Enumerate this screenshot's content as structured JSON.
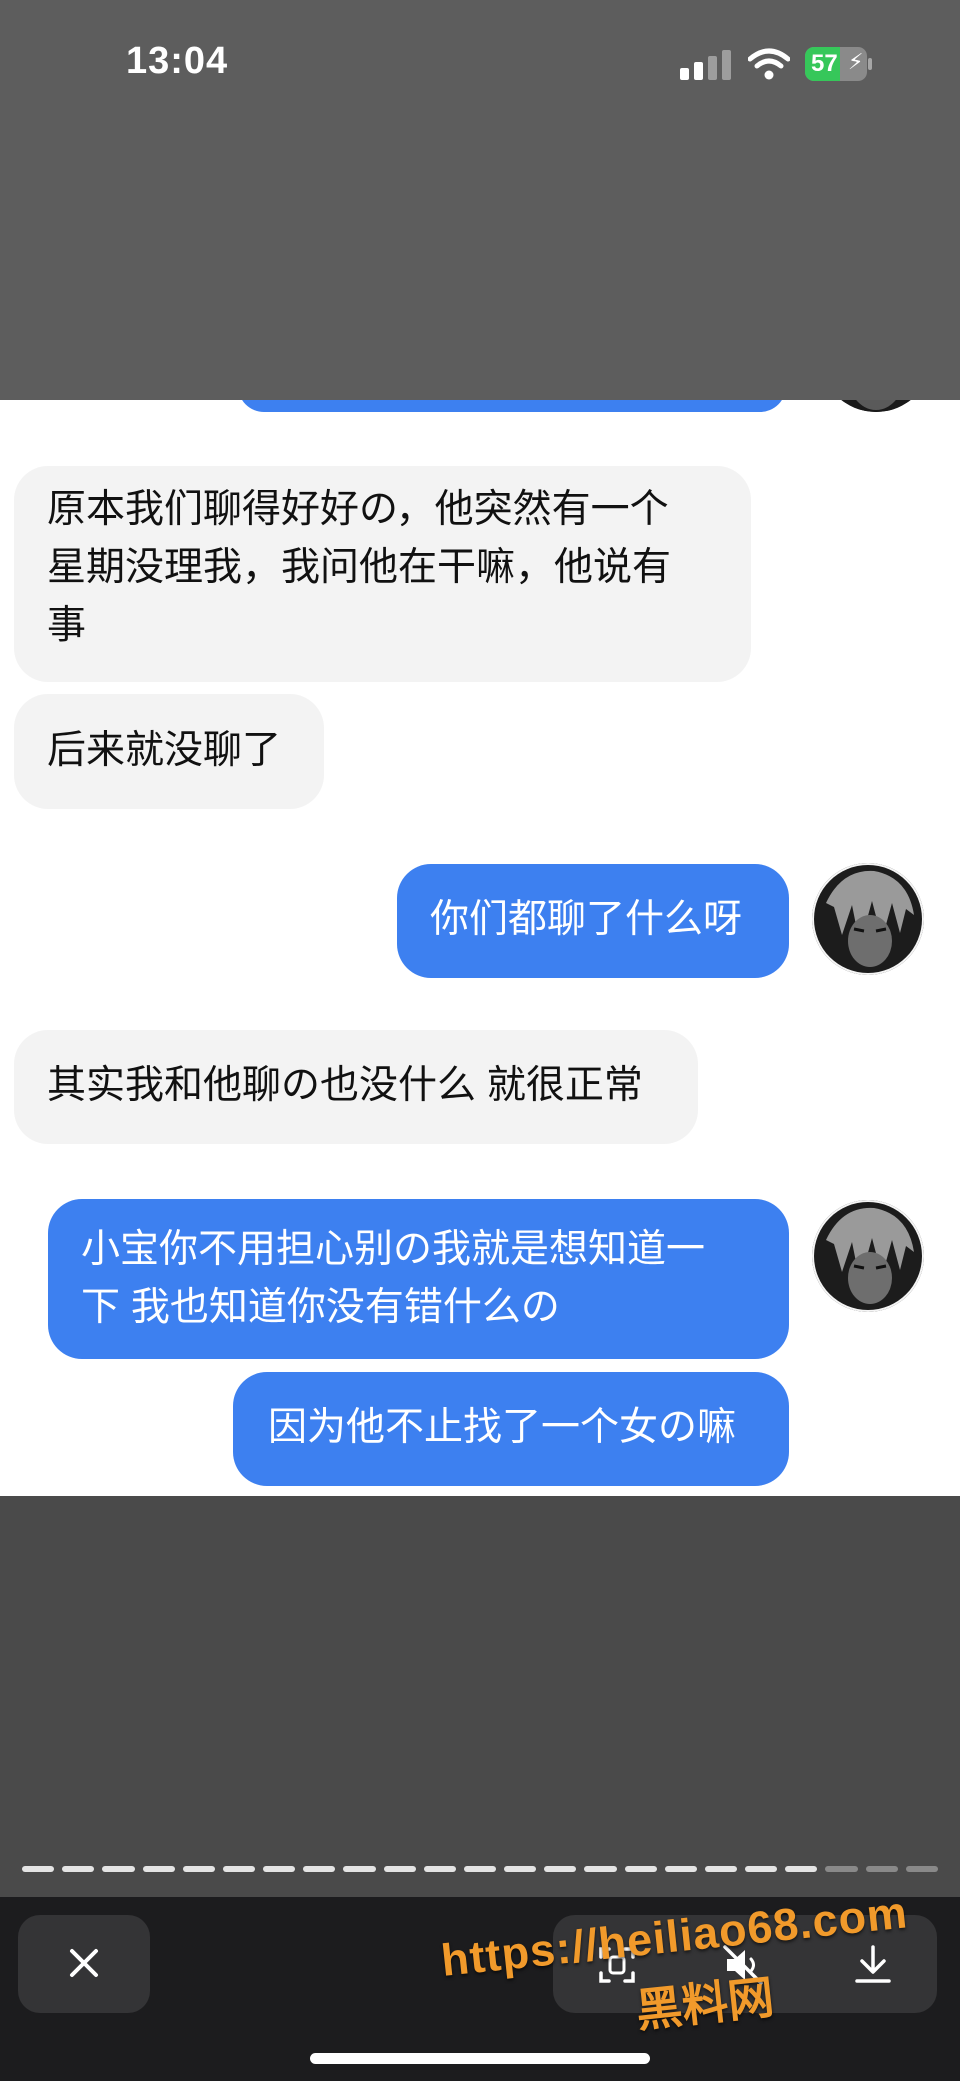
{
  "status_bar": {
    "time": "13:04",
    "battery_percent": 57,
    "battery_label": "57",
    "icons": [
      "cellular-signal-icon",
      "wifi-icon",
      "battery-charging-icon"
    ],
    "battery_color": "#36c75a"
  },
  "chat": {
    "colors": {
      "incoming_bubble": "#f3f3f3",
      "outgoing_bubble": "#3d80f0",
      "background": "#ffffff"
    },
    "messages": [
      {
        "side": "incoming",
        "lines": [
          "原本我们聊得好好の，他突然有一个",
          "星期没理我，我问他在干嘛，他说有",
          "事"
        ]
      },
      {
        "side": "incoming",
        "lines": [
          "后来就没聊了"
        ]
      },
      {
        "side": "outgoing",
        "lines": [
          "你们都聊了什么呀"
        ]
      },
      {
        "side": "incoming",
        "lines": [
          "其实我和他聊の也没什么 就很正常"
        ]
      },
      {
        "side": "outgoing",
        "lines": [
          "小宝你不用担心别の我就是想知道一",
          "下 我也知道你没有错什么の"
        ]
      },
      {
        "side": "outgoing",
        "lines": [
          "因为他不止找了一个女の嘛"
        ]
      }
    ]
  },
  "viewer": {
    "story_segments_total": 23,
    "story_segments_viewed": 20,
    "toolbar": {
      "close_icon": "close-icon",
      "action_icons": [
        "screenshot-icon",
        "mute-icon",
        "download-icon"
      ]
    }
  },
  "watermark": {
    "url": "https://heiliao68.com",
    "name": "黑料网",
    "color": "#f19a2b"
  }
}
